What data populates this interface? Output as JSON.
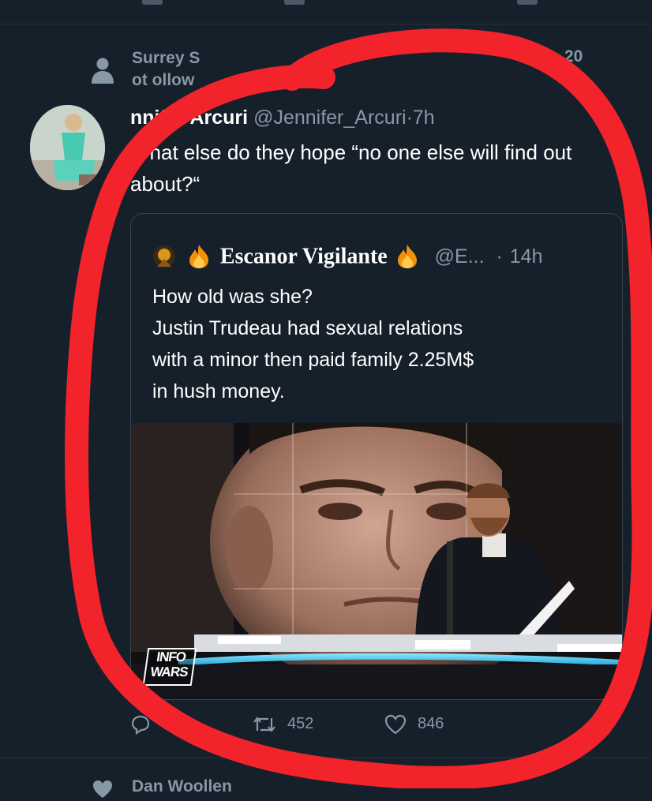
{
  "social_context": {
    "text_line1": "Surrey S",
    "text_line2": "ot     ollow",
    "icon": "person-icon",
    "trailing": "20"
  },
  "tweet": {
    "author_name": "nnifer Arcuri",
    "handle": "@Jennifer_Arcuri",
    "separator": "·",
    "time": "7h",
    "more": "··",
    "text": "What else do they hope “no one else will find out about?“"
  },
  "quote": {
    "name": "Escanor Vigilante",
    "handle": "@E...",
    "separator": "·",
    "time": "14h",
    "text_lines": [
      "How old was she?",
      "Justin Trudeau had sexual relations",
      "with a minor then paid family 2.25M$",
      "in hush money."
    ],
    "media_logo": "INFO WARS"
  },
  "actions": {
    "retweets": "452",
    "likes": "846"
  },
  "next_tweet": {
    "text": "Dan Woollen"
  },
  "colors": {
    "background": "#15202b",
    "secondary_text": "#8899a6",
    "border": "#38444d",
    "annotation": "#f2232b"
  }
}
